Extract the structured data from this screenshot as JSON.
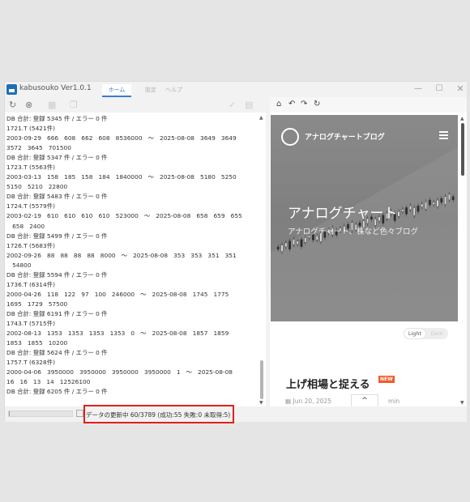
{
  "app": {
    "title": "kabusouko Ver1.0.1",
    "tabs": [
      "ホーム",
      "設定",
      "ヘルプ"
    ],
    "window_controls": {
      "minimize": "—",
      "maximize": "☐",
      "close": "✕"
    }
  },
  "left_toolbar": {
    "icons": [
      "refresh-icon",
      "stop-icon",
      "grid-icon",
      "copy-icon",
      "check-icon",
      "export-icon"
    ]
  },
  "log": {
    "lines": [
      "DB 合計: 登録 5345 件 / エラー 0 件",
      "1721.T (5421件)",
      "2003-09-29   666   608   662   608   8536000   〜   2025-08-08   3649   3649",
      "3572   3645   701500",
      "DB 合計: 登録 5347 件 / エラー 0 件",
      "1723.T (5563件)",
      "2003-03-13   158   185   158   184   1840000   〜   2025-08-08   5180   5250",
      "5150   5210   22800",
      "DB 合計: 登録 5483 件 / エラー 0 件",
      "1724.T (5579件)",
      "2003-02-19   610   610   610   610   523000   〜   2025-08-08   658   659   655",
      "   658   2400",
      "DB 合計: 登録 5499 件 / エラー 0 件",
      "1726.T (5683件)",
      "2002-09-26   88   88   88   88   8000   〜   2025-08-08   353   353   351   351",
      "   54800",
      "DB 合計: 登録 5594 件 / エラー 0 件",
      "1736.T (6314件)",
      "2000-04-26   118   122   97   100   246000   〜   2025-08-08   1745   1775",
      "1695   1729   57500",
      "DB 合計: 登録 6191 件 / エラー 0 件",
      "1743.T (5715件)",
      "2002-08-13   1353   1353   1353   1353   0   〜   2025-08-08   1857   1859",
      "1853   1855   10200",
      "DB 合計: 登録 5624 件 / エラー 0 件",
      "1757.T (6328件)",
      "2000-04-06   3950000   3950000   3950000   3950000   1   〜   2025-08-08",
      "16   16   13   14   12526100",
      "DB 合計: 登録 6205 件 / エラー 0 件"
    ]
  },
  "browser": {
    "nav_icons": {
      "home": "⌂",
      "back": "↶",
      "forward": "↷",
      "reload": "↻"
    },
    "blog_name": "アナログチャートブログ",
    "hero_title": "アナログチャート",
    "hero_subtitle": "アナログチャート、株など色々ブログ",
    "theme_light": "Light",
    "theme_dark": "Dark",
    "post_title": "上げ相場と捉える",
    "post_badge": "NEW",
    "post_date": "Jun 20, 2025",
    "post_read_time": "min",
    "scroll_top": "^"
  },
  "status": {
    "text": "データの更新中 60/3789 (成功:55 失敗:0 未取得:5)",
    "progress_fraction": 0.016
  },
  "colors": {
    "accent": "#3a7bd5",
    "highlight": "#e0201b",
    "badge": "#f25a2c"
  }
}
